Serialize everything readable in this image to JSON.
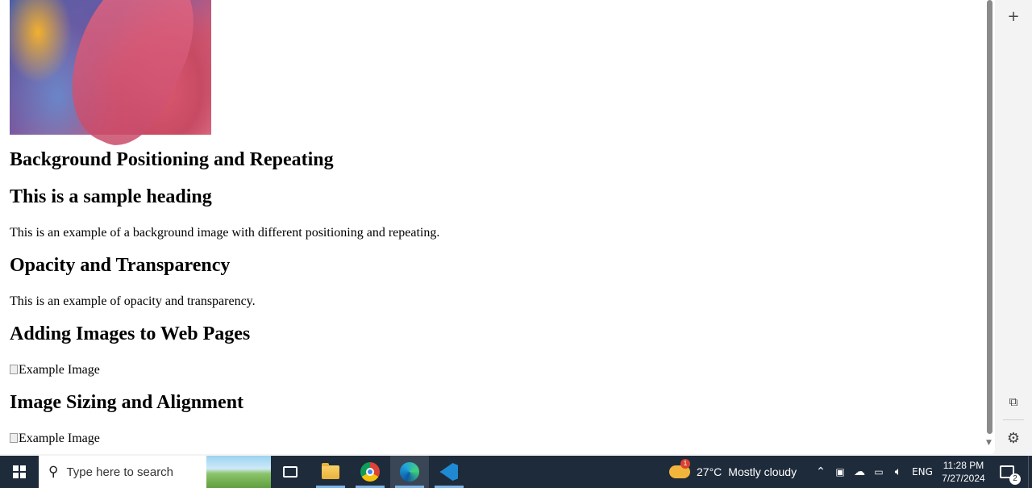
{
  "page": {
    "heading_background": "Background Positioning and Repeating",
    "heading_sample": "This is a sample heading",
    "para_background": "This is an example of a background image with different positioning and repeating.",
    "heading_opacity": "Opacity and Transparency",
    "para_opacity": "This is an example of opacity and transparency.",
    "heading_adding": "Adding Images to Web Pages",
    "img1_alt": "Example Image",
    "heading_sizing": "Image Sizing and Alignment",
    "img2_alt": "Example Image"
  },
  "sidebar": {
    "add_icon": "plus-icon",
    "screenshot_icon": "screenshot-icon",
    "settings_icon": "gear-icon"
  },
  "taskbar": {
    "search_placeholder": "Type here to search",
    "weather_badge": "1",
    "temperature": "27°C",
    "condition": "Mostly cloudy",
    "language": "ENG",
    "time": "11:28 PM",
    "date": "7/27/2024",
    "notification_count": "2"
  },
  "colors": {
    "taskbar_bg": "#1e2b3b",
    "page_bg": "#ffffff",
    "accent": "#7fb4e6"
  }
}
